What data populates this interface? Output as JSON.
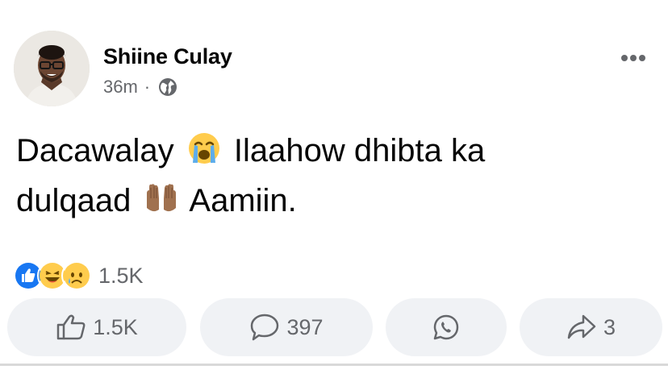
{
  "post": {
    "author": "Shiine Culay",
    "time": "36m",
    "separator": "·",
    "privacy_icon": "globe-icon",
    "more_icon": "more-horizontal-icon",
    "text_line1_a": "Dacawalay",
    "text_line1_emoji": "loudly-crying-face-emoji",
    "text_line1_b": "Ilaahow dhibta ka",
    "text_line2_a": "dulqaad",
    "text_line2_emoji": "raised-hands-emoji",
    "text_line2_b": "Aamiin."
  },
  "reactions": {
    "icons": [
      "like-reaction-icon",
      "haha-reaction-icon",
      "sad-reaction-icon"
    ],
    "count": "1.5K"
  },
  "actions": {
    "like_count": "1.5K",
    "comment_count": "397",
    "whatsapp_icon": "whatsapp-icon",
    "share_count": "3"
  },
  "colors": {
    "text": "#050505",
    "secondary": "#65676b",
    "button_bg": "#f0f2f5",
    "like_blue": "#1877f2",
    "emoji_yellow": "#ffcc4d"
  }
}
